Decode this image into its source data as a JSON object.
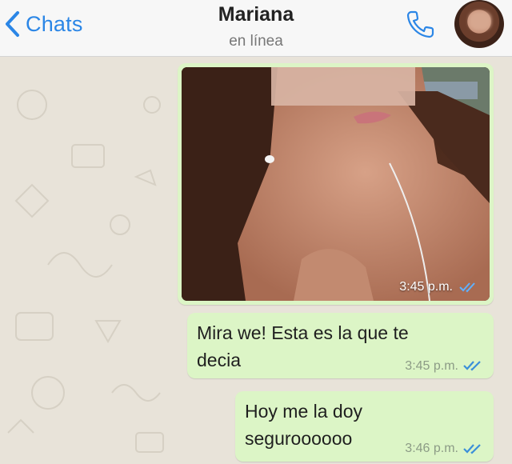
{
  "header": {
    "back_label": "Chats",
    "contact_name": "Mariana",
    "status": "en línea"
  },
  "colors": {
    "accent": "#2b86e6",
    "outgoing_bubble": "#dcf5c6",
    "tick_blue": "#3b8fd9"
  },
  "icons": {
    "back": "chevron-left-icon",
    "call": "phone-icon",
    "read_receipt": "double-check-icon"
  },
  "messages": [
    {
      "type": "image",
      "time": "3:45 p.m."
    },
    {
      "type": "text",
      "text": "Mira we! Esta es la que te\ndecia",
      "time": "3:45 p.m."
    },
    {
      "type": "text",
      "text": "Hoy me la doy\nseguroooooo",
      "time": "3:46 p.m."
    }
  ]
}
